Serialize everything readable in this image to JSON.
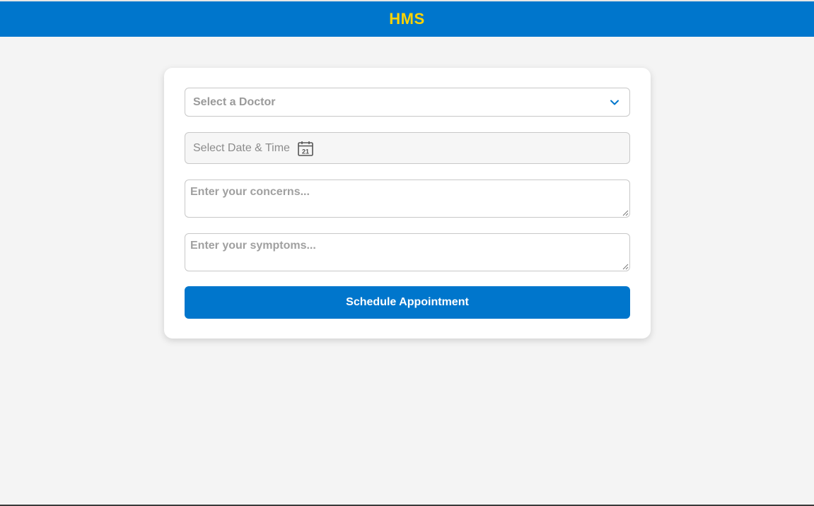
{
  "header": {
    "title": "HMS"
  },
  "form": {
    "doctor_select": {
      "placeholder": "Select a Doctor",
      "icon": "chevron-down-icon"
    },
    "datetime": {
      "placeholder": "Select Date & Time",
      "icon": "calendar-icon",
      "icon_text": "21"
    },
    "concerns": {
      "placeholder": "Enter your concerns..."
    },
    "symptoms": {
      "placeholder": "Enter your symptoms..."
    },
    "submit_label": "Schedule Appointment"
  },
  "colors": {
    "brand": "#0076cc",
    "title": "#ffd400",
    "background": "#f4f4f4"
  }
}
